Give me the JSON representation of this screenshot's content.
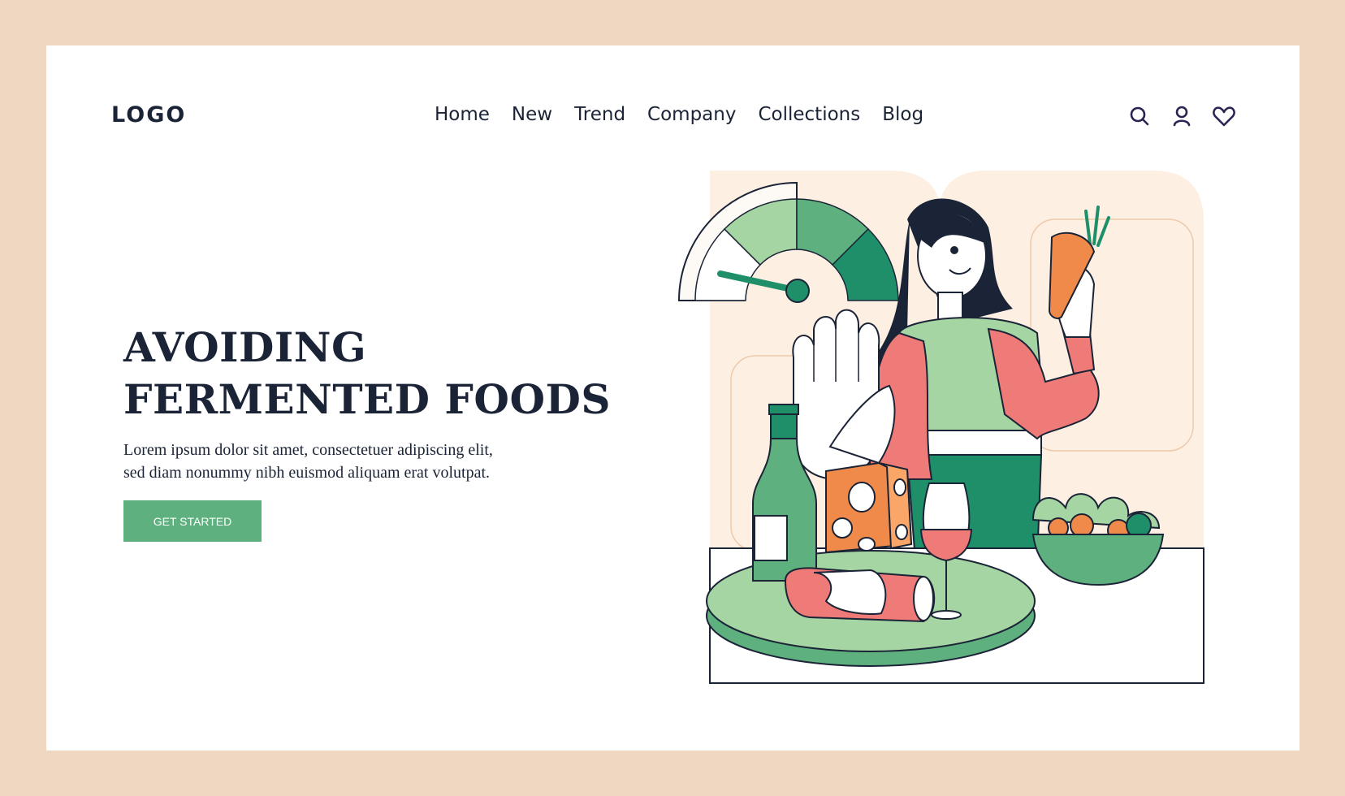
{
  "header": {
    "logo": "LOGO",
    "nav": [
      "Home",
      "New",
      "Trend",
      "Company",
      "Collections",
      "Blog"
    ],
    "icons": [
      "search-icon",
      "user-icon",
      "heart-icon"
    ]
  },
  "hero": {
    "title_line1": "AVOIDING",
    "title_line2": "FERMENTED FOODS",
    "text_line1": "Lorem ipsum dolor sit amet, consectetuer adipiscing elit,",
    "text_line2": "sed diam nonummy nibh euismod aliquam erat volutpat.",
    "cta": "GET STARTED"
  },
  "colors": {
    "frame": "#efd7c1",
    "panel": "#fdf0e3",
    "green": "#5fb07f",
    "dark_green": "#1f8f6a",
    "coral": "#ef7b78",
    "orange": "#f08a4b",
    "navy": "#1b2336"
  }
}
